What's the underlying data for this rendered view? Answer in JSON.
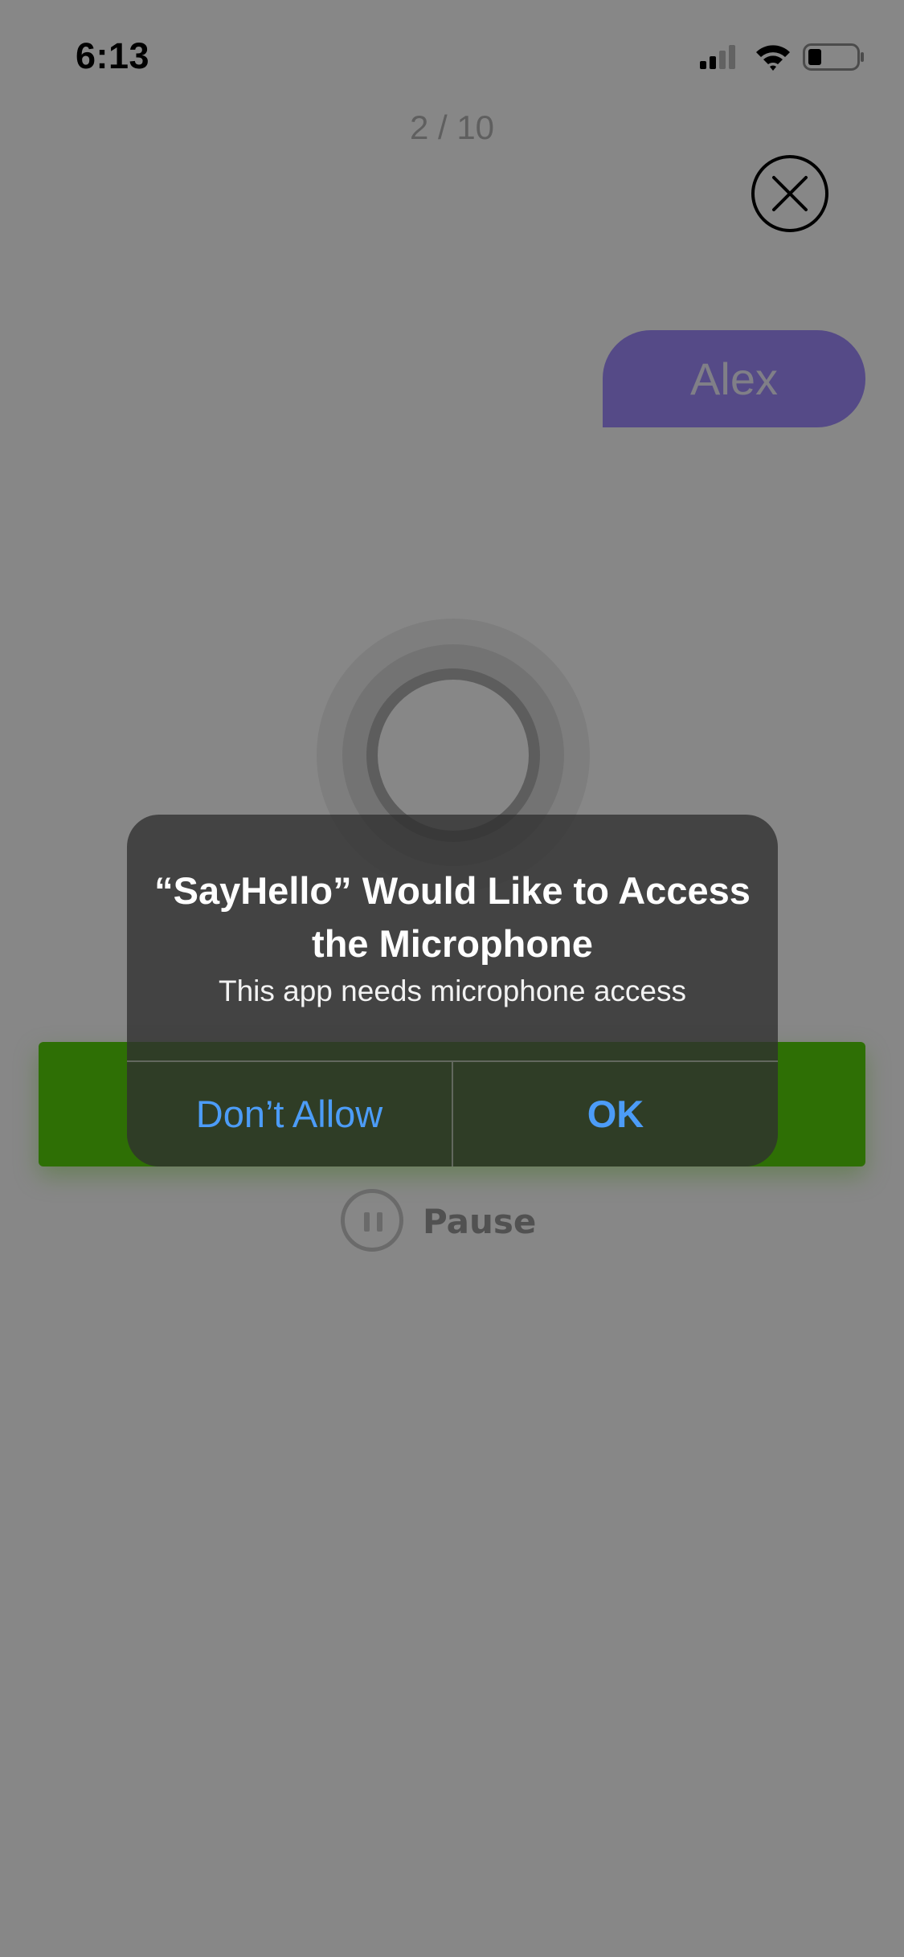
{
  "status_bar": {
    "time": "6:13"
  },
  "lesson": {
    "progress_label": "2 / 10",
    "speaker_name": "Alex",
    "pause_label": "Pause"
  },
  "alert": {
    "title": "“SayHello” Would Like to Access the Microphone",
    "message": "This app needs microphone access",
    "deny_label": "Don’t Allow",
    "ok_label": "OK"
  },
  "colors": {
    "bubble": "#a08cff",
    "action_bar": "#58d10a",
    "alert_button_text": "#4c9cf7",
    "overlay": "rgba(0,0,0,0.47)"
  },
  "icons": {
    "close": "close-icon",
    "pause": "pause-icon",
    "signal": "cellular-signal-icon",
    "wifi": "wifi-icon",
    "battery": "battery-icon",
    "record": "record-icon"
  }
}
